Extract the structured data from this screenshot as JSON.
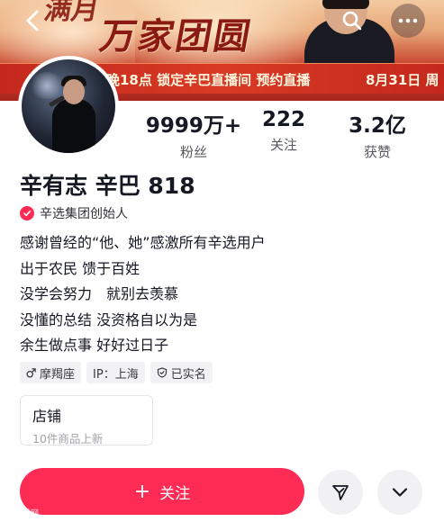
{
  "banner": {
    "calligraphy_top": "满月",
    "calligraphy": "万家团圆",
    "live_text": "晚18点 锁定辛巴直播间 预约直播",
    "date_text": "8月31日 周"
  },
  "profile": {
    "name": "辛有志 辛巴 818",
    "verification": "辛选集团创始人",
    "stats": [
      {
        "value": "9999万+",
        "label": "粉丝"
      },
      {
        "value": "222",
        "label": "关注"
      },
      {
        "value": "3.2亿",
        "label": "获赞"
      }
    ],
    "bio": [
      "感谢曾经的“他、她”感激所有辛选用户",
      "出于农民 馈于百姓",
      "没学会努力　就别去羡慕",
      "没懂的总结 没资格自以为是",
      "余生做点事 好好过日子"
    ],
    "tags": [
      "摩羯座",
      "IP：上海",
      "已实名"
    ]
  },
  "shop": {
    "title": "店铺",
    "subtitle": "10件商品上新"
  },
  "actions": {
    "follow_plus": "+",
    "follow_label": "关注"
  },
  "icons": {
    "back": "back-icon",
    "search": "search-icon",
    "more": "more-icon",
    "verified": "verified-check-icon",
    "male": "male-icon",
    "verified_id": "shield-check-icon",
    "share": "share-send-icon",
    "dropdown": "chevron-down-icon"
  },
  "colors": {
    "accent": "#fe2c55",
    "text": "#161823",
    "secondary": "#57595f"
  },
  "watermark": "人民网"
}
